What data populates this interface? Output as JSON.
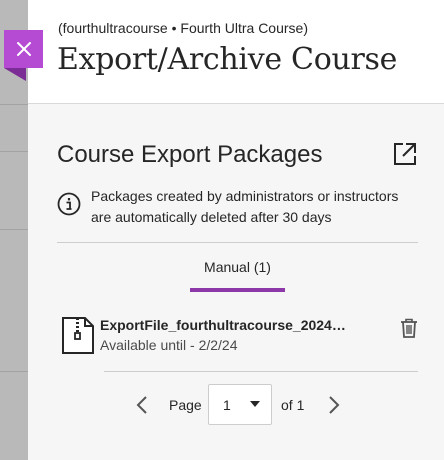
{
  "header": {
    "breadcrumb": "(fourthultracourse • Fourth Ultra Course)",
    "title": "Export/Archive Course",
    "close_icon": "close-icon",
    "accent_color": "#b54ad3"
  },
  "section": {
    "title": "Course Export Packages",
    "open_icon": "external-link-icon"
  },
  "notice": {
    "icon": "info-icon",
    "text": "Packages created by administrators or instructors are automatically deleted after 30 days"
  },
  "tabs": [
    {
      "label": "Manual (1)",
      "selected": true,
      "underline_color": "#8c38a8"
    }
  ],
  "files": [
    {
      "icon": "zip-file-icon",
      "name": "ExportFile_fourthultracourse_2024…",
      "availability": "Available until - 2/2/24",
      "delete_icon": "trash-icon"
    }
  ],
  "pagination": {
    "page_label": "Page",
    "current_page": "1",
    "of_label": "of 1",
    "prev_icon": "chevron-left-icon",
    "next_icon": "chevron-right-icon",
    "dropdown_icon": "caret-down-icon"
  }
}
